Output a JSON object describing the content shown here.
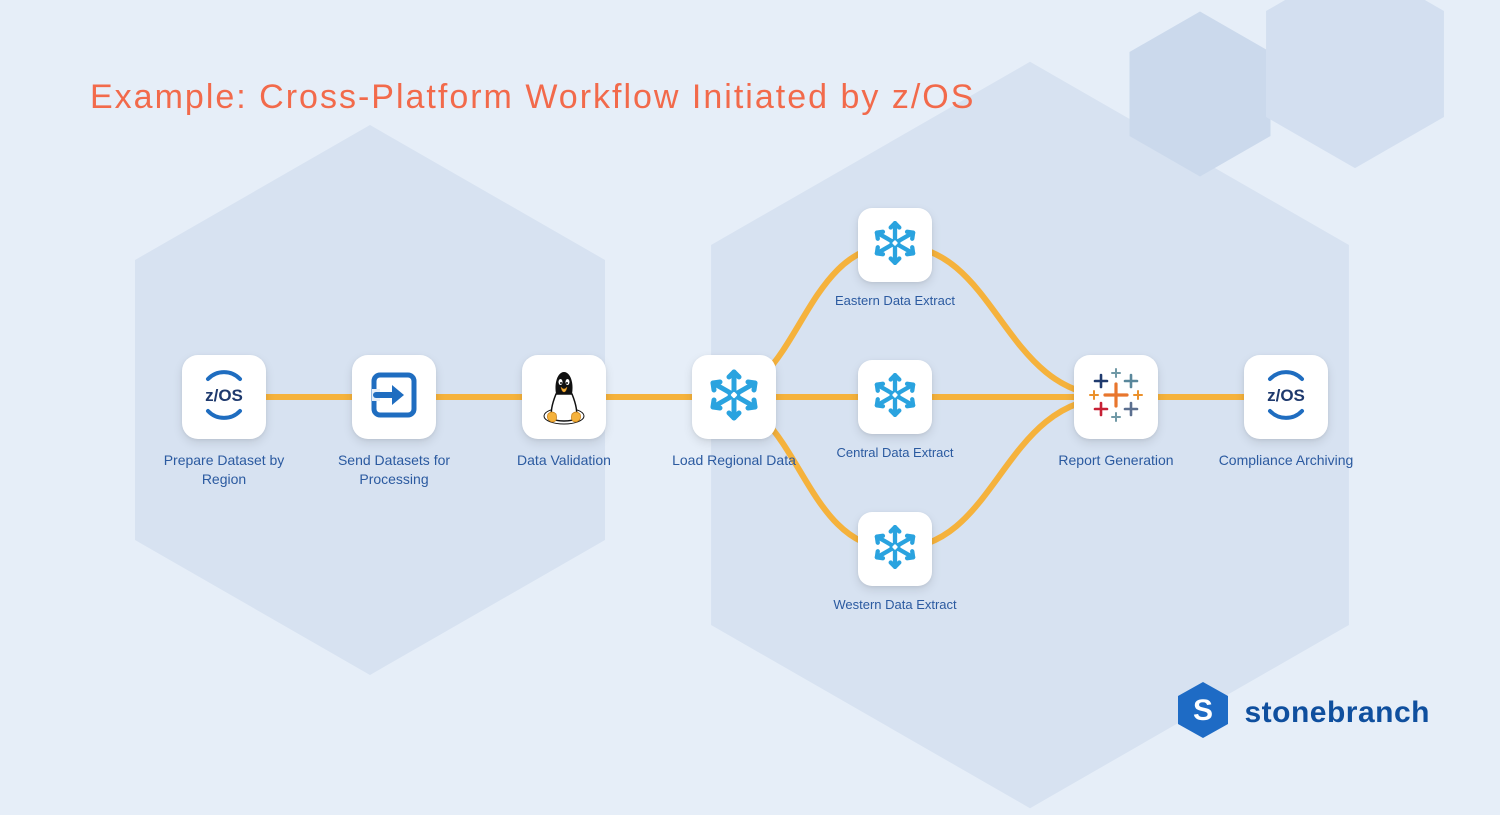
{
  "title": "Example: Cross-Platform Workflow Initiated by z/OS",
  "nodes": {
    "prepare": {
      "label": "Prepare Dataset by Region",
      "icon": "zos"
    },
    "send": {
      "label": "Send Datasets for Processing",
      "icon": "arrow-in"
    },
    "validate": {
      "label": "Data Validation",
      "icon": "linux"
    },
    "load": {
      "label": "Load Regional Data",
      "icon": "snowflake"
    },
    "eastern": {
      "label": "Eastern Data Extract",
      "icon": "snowflake"
    },
    "central": {
      "label": "Central Data Extract",
      "icon": "snowflake"
    },
    "western": {
      "label": "Western Data Extract",
      "icon": "snowflake"
    },
    "report": {
      "label": "Report Generation",
      "icon": "tableau"
    },
    "compliance": {
      "label": "Compliance Archiving",
      "icon": "zos"
    }
  },
  "brand": {
    "name": "stonebranch",
    "mark_letter": "S"
  },
  "colors": {
    "connector": "#f5b23c",
    "title": "#f26a4b",
    "label": "#2b5aa0",
    "background": "#e6eef8",
    "hex_shade": "#d7e2f1",
    "brand": "#0f4f9e"
  }
}
